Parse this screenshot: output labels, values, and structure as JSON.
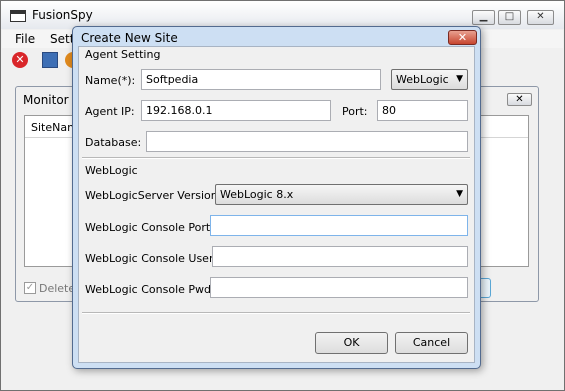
{
  "main_window": {
    "title": "FusionSpy",
    "menu": [
      "File",
      "Settin"
    ],
    "toolbar_icons": [
      "stop-icon",
      "monitor-icon",
      "orange-globe-icon"
    ],
    "monitor_panel": {
      "title": "Monitor S",
      "columns": [
        "SiteName"
      ],
      "delete_label": "Delete"
    },
    "window_buttons": {
      "minimize": "▁",
      "maximize": "□",
      "close": "✕"
    }
  },
  "dialog": {
    "title": "Create New Site",
    "close_glyph": "✕",
    "agent_section": "Agent Setting",
    "name_label": "Name(*):",
    "name_value": "Softpedia",
    "server_type": "WebLogic",
    "agent_ip_label": "Agent IP:",
    "agent_ip_value": "192.168.0.1",
    "port_label": "Port:",
    "port_value": "80",
    "database_label": "Database:",
    "database_value": "",
    "weblogic_section": "WebLogic",
    "version_label": "WebLogicServer Version:",
    "version_value": "WebLogic 8.x",
    "console_port_label": "WebLogic Console Port:",
    "console_port_value": "",
    "console_user_label": "WebLogic Console User:",
    "console_user_value": "",
    "console_pwd_label": "WebLogic Console Pwd:",
    "console_pwd_value": "",
    "ok_label": "OK",
    "cancel_label": "Cancel",
    "dropdown_arrow": "▼"
  }
}
